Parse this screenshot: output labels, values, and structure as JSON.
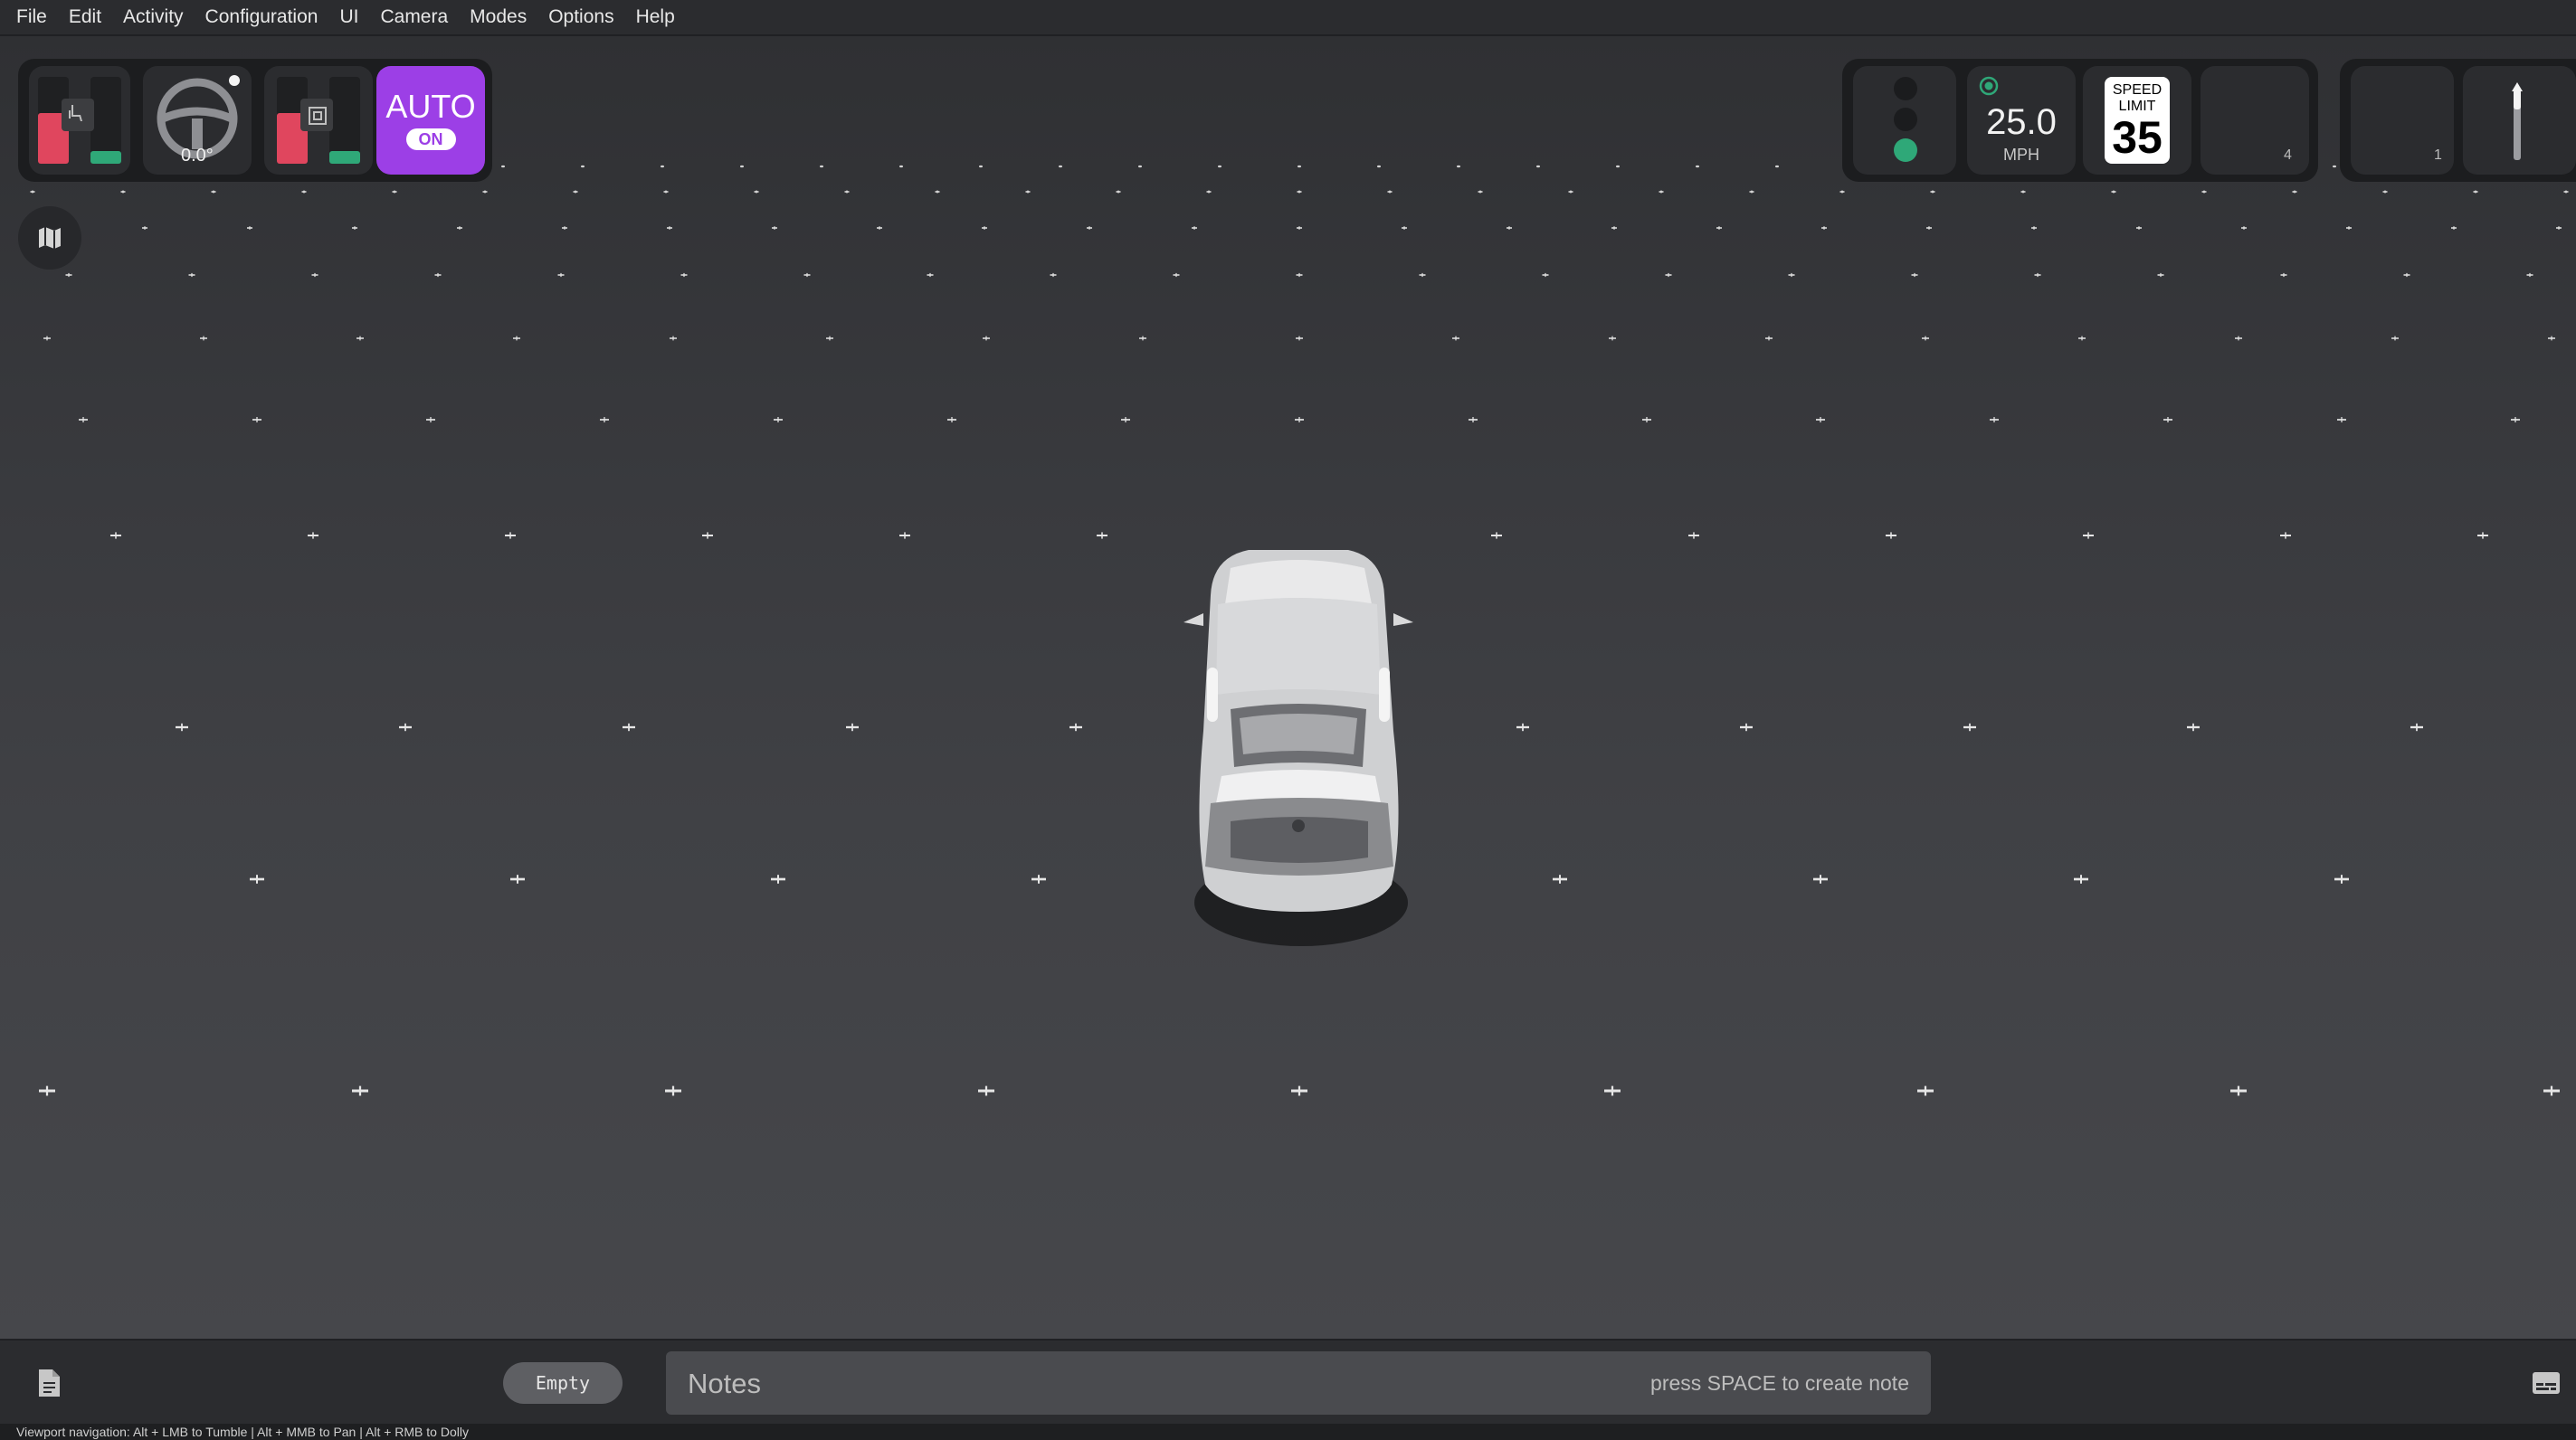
{
  "menu": [
    "File",
    "Edit",
    "Activity",
    "Configuration",
    "UI",
    "Camera",
    "Modes",
    "Options",
    "Help"
  ],
  "hud_left": {
    "steering_angle": "0.0°",
    "auto_label": "AUTO",
    "auto_state": "ON"
  },
  "hud_right": {
    "traffic_light_active": "green",
    "speed_value": "25.0",
    "speed_unit": "MPH",
    "speed_limit_line1": "SPEED",
    "speed_limit_line2": "LIMIT",
    "speed_limit_value": "35",
    "tile_four_number": "4",
    "tile_gear_number": "1"
  },
  "bottom": {
    "empty_label": "Empty",
    "notes_label": "Notes",
    "notes_hint": "press SPACE to create note"
  },
  "status_text": "Viewport navigation: Alt + LMB to Tumble | Alt + MMB to Pan | Alt + RMB to Dolly",
  "colors": {
    "accent_auto": "#9c3fe6",
    "brake_red": "#e0465e",
    "throttle_green": "#2fa878",
    "light_green": "#2fa878"
  },
  "icons": {
    "map": "map-icon",
    "notes_doc": "document-icon",
    "subtitles": "subtitles-icon",
    "steering": "steering-wheel-icon",
    "seat": "seat-icon",
    "gps": "gps-target-icon"
  }
}
